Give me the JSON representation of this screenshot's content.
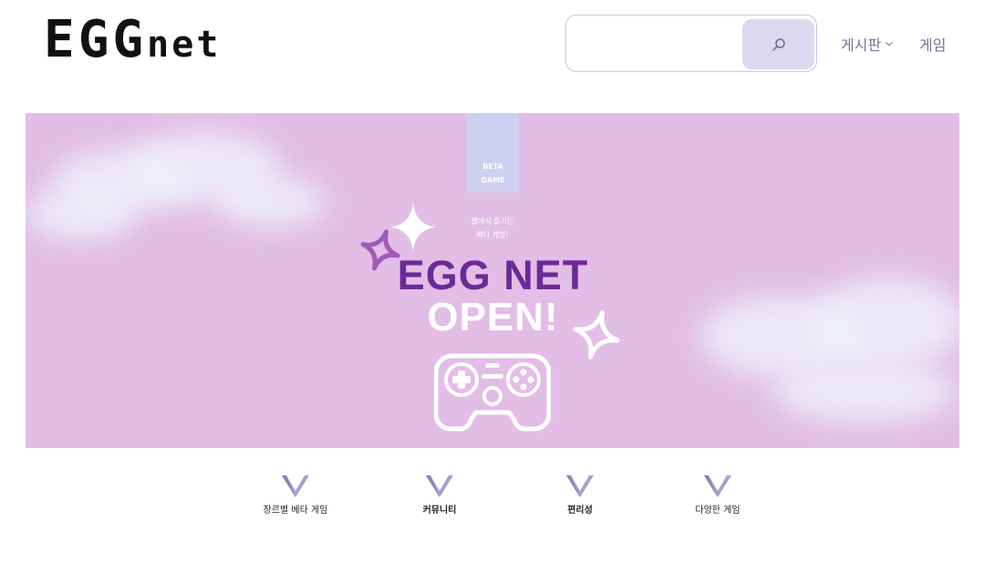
{
  "header": {
    "logo_big": "EGG",
    "logo_small": "net",
    "search": {
      "value": "",
      "placeholder": ""
    },
    "nav": {
      "board": "게시판",
      "game": "게임"
    }
  },
  "banner": {
    "tag": [
      "BETA",
      "GAME"
    ],
    "subtitle": [
      "웹에서 즐기는",
      "베타 게임!"
    ],
    "title_line1": "EGG NET",
    "title_line2": "OPEN!"
  },
  "features": [
    {
      "label": "장르별 베타 게임",
      "bold": false
    },
    {
      "label": "커뮤니티",
      "bold": true
    },
    {
      "label": "편리성",
      "bold": true
    },
    {
      "label": "다양한 게임",
      "bold": false
    }
  ],
  "colors": {
    "banner_bg": "#e2bde6",
    "title_purple": "#6a2a98",
    "search_btn": "#ddd8ef",
    "nav_text": "#7a6f95",
    "beta_tag": "#cdd0f0"
  },
  "icons": [
    "search-icon",
    "chevron-down-icon",
    "sparkle-icon",
    "gamepad-icon",
    "chevron-v-icon"
  ]
}
